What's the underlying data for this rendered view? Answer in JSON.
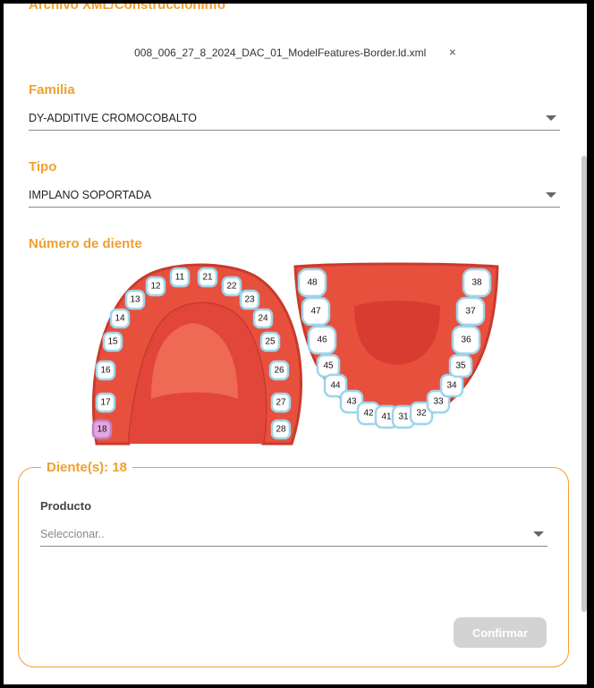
{
  "file": {
    "section_title": "Archivo XML/Construccioninfo",
    "file_name": "008_006_27_8_2024_DAC_01_ModelFeatures-Border.ld.xml",
    "remove_glyph": "×"
  },
  "familia": {
    "title": "Familia",
    "value": "DY-ADDITIVE CROMOCOBALTO"
  },
  "tipo": {
    "title": "Tipo",
    "value": "IMPLANO SOPORTADA"
  },
  "diente": {
    "title": "Número de diente",
    "upper_teeth": [
      "11",
      "12",
      "13",
      "14",
      "15",
      "16",
      "17",
      "18",
      "21",
      "22",
      "23",
      "24",
      "25",
      "26",
      "27",
      "28"
    ],
    "lower_teeth": [
      "48",
      "47",
      "46",
      "45",
      "44",
      "43",
      "42",
      "41",
      "31",
      "32",
      "33",
      "34",
      "35",
      "36",
      "37",
      "38"
    ],
    "selected_tooth": "18",
    "colors": {
      "gum": "#e8503e",
      "gum_dark": "#c93a2c",
      "palate": "#e2463a",
      "tooth": "#ffffff",
      "tooth_outline": "#9ed4ea",
      "selected": "#e6a6e0"
    }
  },
  "selection": {
    "legend": "Diente(s): 18",
    "producto_label": "Producto",
    "producto_placeholder": "Seleccionar..",
    "confirm_label": "Confirmar"
  },
  "accent_color": "#f0a030"
}
